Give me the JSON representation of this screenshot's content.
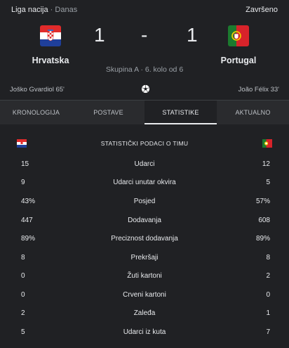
{
  "header": {
    "league": "Liga nacija",
    "separator": "·",
    "when": "Danas",
    "status": "Završeno"
  },
  "match": {
    "home": {
      "name": "Hrvatska",
      "score": "1",
      "scorer": "Joško Gvardiol 65'"
    },
    "away": {
      "name": "Portugal",
      "score": "1",
      "scorer": "João Félix 33'"
    },
    "dash": "-",
    "group": "Skupina A · 6. kolo od 6"
  },
  "tabs": [
    {
      "label": "KRONOLOGIJA"
    },
    {
      "label": "POSTAVE"
    },
    {
      "label": "STATISTIKE"
    },
    {
      "label": "AKTUALNO"
    }
  ],
  "active_tab": "STATISTIKE",
  "stats": {
    "title": "STATISTIČKI PODACI O TIMU",
    "rows": [
      {
        "label": "Udarci",
        "home": "15",
        "away": "12"
      },
      {
        "label": "Udarci unutar okvira",
        "home": "9",
        "away": "5"
      },
      {
        "label": "Posjed",
        "home": "43%",
        "away": "57%"
      },
      {
        "label": "Dodavanja",
        "home": "447",
        "away": "608"
      },
      {
        "label": "Preciznost dodavanja",
        "home": "89%",
        "away": "89%"
      },
      {
        "label": "Prekršaji",
        "home": "8",
        "away": "8"
      },
      {
        "label": "Žuti kartoni",
        "home": "0",
        "away": "2"
      },
      {
        "label": "Crveni kartoni",
        "home": "0",
        "away": "0"
      },
      {
        "label": "Zaleđa",
        "home": "2",
        "away": "1"
      },
      {
        "label": "Udarci iz kuta",
        "home": "5",
        "away": "7"
      }
    ]
  },
  "colors": {
    "background": "#202124",
    "tab_bar": "#2a2b2e",
    "text": "#e8eaed",
    "muted": "#9aa0a6"
  },
  "icons": {
    "home_flag": "croatia-flag-icon",
    "away_flag": "portugal-flag-icon",
    "ball": "soccer-ball-icon"
  }
}
